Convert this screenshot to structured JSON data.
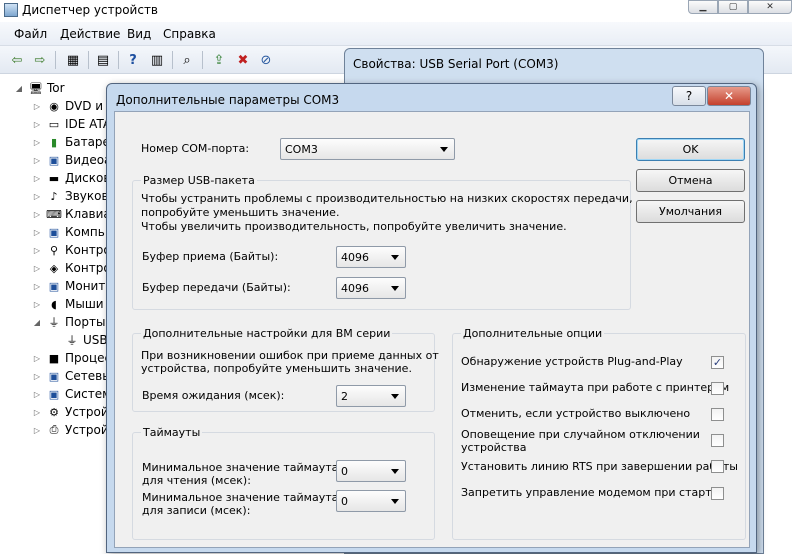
{
  "window": {
    "title": "Диспетчер устройств"
  },
  "menu": [
    "Файл",
    "Действие",
    "Вид",
    "Справка"
  ],
  "tree": {
    "root": "Tor",
    "items": [
      "DVD и с",
      "IDE ATA",
      "Батаре",
      "Видеоа",
      "Дисков",
      "Звуков",
      "Клавиа",
      "Компь",
      "Контро",
      "Контро",
      "Монит",
      "Мыши",
      "Порты",
      "USB",
      "Процес",
      "Сетевы",
      "Систем",
      "Устрой",
      "Устрой"
    ]
  },
  "props_dialog": {
    "title": "Свойства: USB Serial Port (COM3)"
  },
  "dialog": {
    "title": "Дополнительные параметры COM3",
    "help": "?",
    "close": "✕",
    "com_port_label": "Номер COM-порта:",
    "com_port_value": "COM3",
    "buttons": {
      "ok": "OK",
      "cancel": "Отмена",
      "defaults": "Умолчания"
    },
    "usb": {
      "title": "Размер USB-пакета",
      "desc1": "Чтобы устранить проблемы с производительностью на низких скоростях передачи,",
      "desc2": "попробуйте уменьшить значение.",
      "desc3": "Чтобы увеличить производительность, попробуйте увеличить значение.",
      "rx_label": "Буфер приема (Байты):",
      "rx_value": "4096",
      "tx_label": "Буфер передачи (Байты):",
      "tx_value": "4096"
    },
    "bm": {
      "title": "Дополнительные настройки для BM серии",
      "desc1": "При возникновении ошибок при приеме данных от",
      "desc2": "устройства, попробуйте уменьшить значение.",
      "latency_label": "Время ожидания (мсек):",
      "latency_value": "2"
    },
    "timeouts": {
      "title": "Таймауты",
      "read_label1": "Минимальное значение таймаута",
      "read_label2": "для чтения (мсек):",
      "read_value": "0",
      "write_label1": "Минимальное значение таймаута",
      "write_label2": "для записи (мсек):",
      "write_value": "0"
    },
    "options": {
      "title": "Дополнительные опции",
      "items": [
        {
          "label": "Обнаружение устройств Plug-and-Play",
          "checked": "✓"
        },
        {
          "label": "Изменение таймаута при работе с принтером",
          "checked": ""
        },
        {
          "label": "Отменить, если устройство выключено",
          "checked": ""
        },
        {
          "label": "Оповещение при случайном отключении",
          "label2": "устройства",
          "checked": ""
        },
        {
          "label": "Установить линию RTS при завершении работы",
          "checked": ""
        },
        {
          "label": "Запретить управление модемом при старте",
          "checked": ""
        }
      ]
    }
  }
}
